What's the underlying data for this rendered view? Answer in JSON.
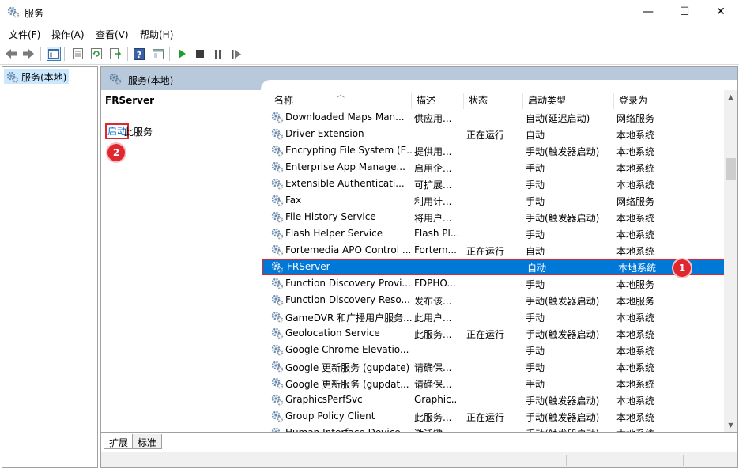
{
  "window": {
    "title": "服务",
    "minimize_label": "—",
    "maximize_label": "☐",
    "close_label": "✕"
  },
  "menu": [
    "文件(F)",
    "操作(A)",
    "查看(V)",
    "帮助(H)"
  ],
  "toolbar": {
    "icons": [
      "back-icon",
      "forward-icon",
      "show-hide-tree-icon",
      "properties-icon",
      "refresh-icon",
      "export-list-icon",
      "help-icon",
      "console-icon",
      "start-service-icon",
      "stop-service-icon",
      "pause-service-icon",
      "restart-service-icon"
    ]
  },
  "tree": {
    "selected_item": "服务(本地)"
  },
  "pane": {
    "header_title": "服务(本地)",
    "selected_service_name": "FRServer",
    "start_link": "启动",
    "start_suffix": "此服务",
    "annotation_1": "1",
    "annotation_2": "2"
  },
  "columns": {
    "name": "名称",
    "description": "描述",
    "status": "状态",
    "startup_type": "启动类型",
    "logon_as": "登录为"
  },
  "services": [
    {
      "name": "Downloaded Maps Man...",
      "description": "供应用...",
      "status": "",
      "startup": "自动(延迟启动)",
      "logon": "网络服务"
    },
    {
      "name": "Driver Extension",
      "description": "",
      "status": "正在运行",
      "startup": "自动",
      "logon": "本地系统"
    },
    {
      "name": "Encrypting File System (E...",
      "description": "提供用...",
      "status": "",
      "startup": "手动(触发器启动)",
      "logon": "本地系统"
    },
    {
      "name": "Enterprise App Manage...",
      "description": "启用企...",
      "status": "",
      "startup": "手动",
      "logon": "本地系统"
    },
    {
      "name": "Extensible Authenticati...",
      "description": "可扩展...",
      "status": "",
      "startup": "手动",
      "logon": "本地系统"
    },
    {
      "name": "Fax",
      "description": "利用计...",
      "status": "",
      "startup": "手动",
      "logon": "网络服务"
    },
    {
      "name": "File History Service",
      "description": "将用户...",
      "status": "",
      "startup": "手动(触发器启动)",
      "logon": "本地系统"
    },
    {
      "name": "Flash Helper Service",
      "description": "Flash Pl...",
      "status": "",
      "startup": "手动",
      "logon": "本地系统"
    },
    {
      "name": "Fortemedia APO Control ...",
      "description": "Fortem...",
      "status": "正在运行",
      "startup": "自动",
      "logon": "本地系统"
    },
    {
      "name": "FRServer",
      "description": "",
      "status": "",
      "startup": "自动",
      "logon": "本地系统",
      "selected": true
    },
    {
      "name": "Function Discovery Provi...",
      "description": "FDPHO...",
      "status": "",
      "startup": "手动",
      "logon": "本地服务"
    },
    {
      "name": "Function Discovery Reso...",
      "description": "发布该...",
      "status": "",
      "startup": "手动(触发器启动)",
      "logon": "本地服务"
    },
    {
      "name": "GameDVR 和广播用户服务...",
      "description": "此用户...",
      "status": "",
      "startup": "手动",
      "logon": "本地系统"
    },
    {
      "name": "Geolocation Service",
      "description": "此服务...",
      "status": "正在运行",
      "startup": "手动(触发器启动)",
      "logon": "本地系统"
    },
    {
      "name": "Google Chrome Elevatio...",
      "description": "",
      "status": "",
      "startup": "手动",
      "logon": "本地系统"
    },
    {
      "name": "Google 更新服务 (gupdate)",
      "description": "请确保...",
      "status": "",
      "startup": "手动",
      "logon": "本地系统"
    },
    {
      "name": "Google 更新服务 (gupdat...",
      "description": "请确保...",
      "status": "",
      "startup": "手动",
      "logon": "本地系统"
    },
    {
      "name": "GraphicsPerfSvc",
      "description": "Graphic...",
      "status": "",
      "startup": "手动(触发器启动)",
      "logon": "本地系统"
    },
    {
      "name": "Group Policy Client",
      "description": "此服务...",
      "status": "正在运行",
      "startup": "手动(触发器启动)",
      "logon": "本地系统"
    },
    {
      "name": "Human Interface Device ...",
      "description": "激活键...",
      "status": "",
      "startup": "手动(触发器启动)",
      "logon": "本地系统"
    }
  ],
  "tabs": [
    "扩展",
    "标准"
  ],
  "colors": {
    "selection": "#0078d7",
    "annotation_red": "#e0262f",
    "header_blue": "#b9c9dc",
    "link_blue": "#0066cc"
  }
}
